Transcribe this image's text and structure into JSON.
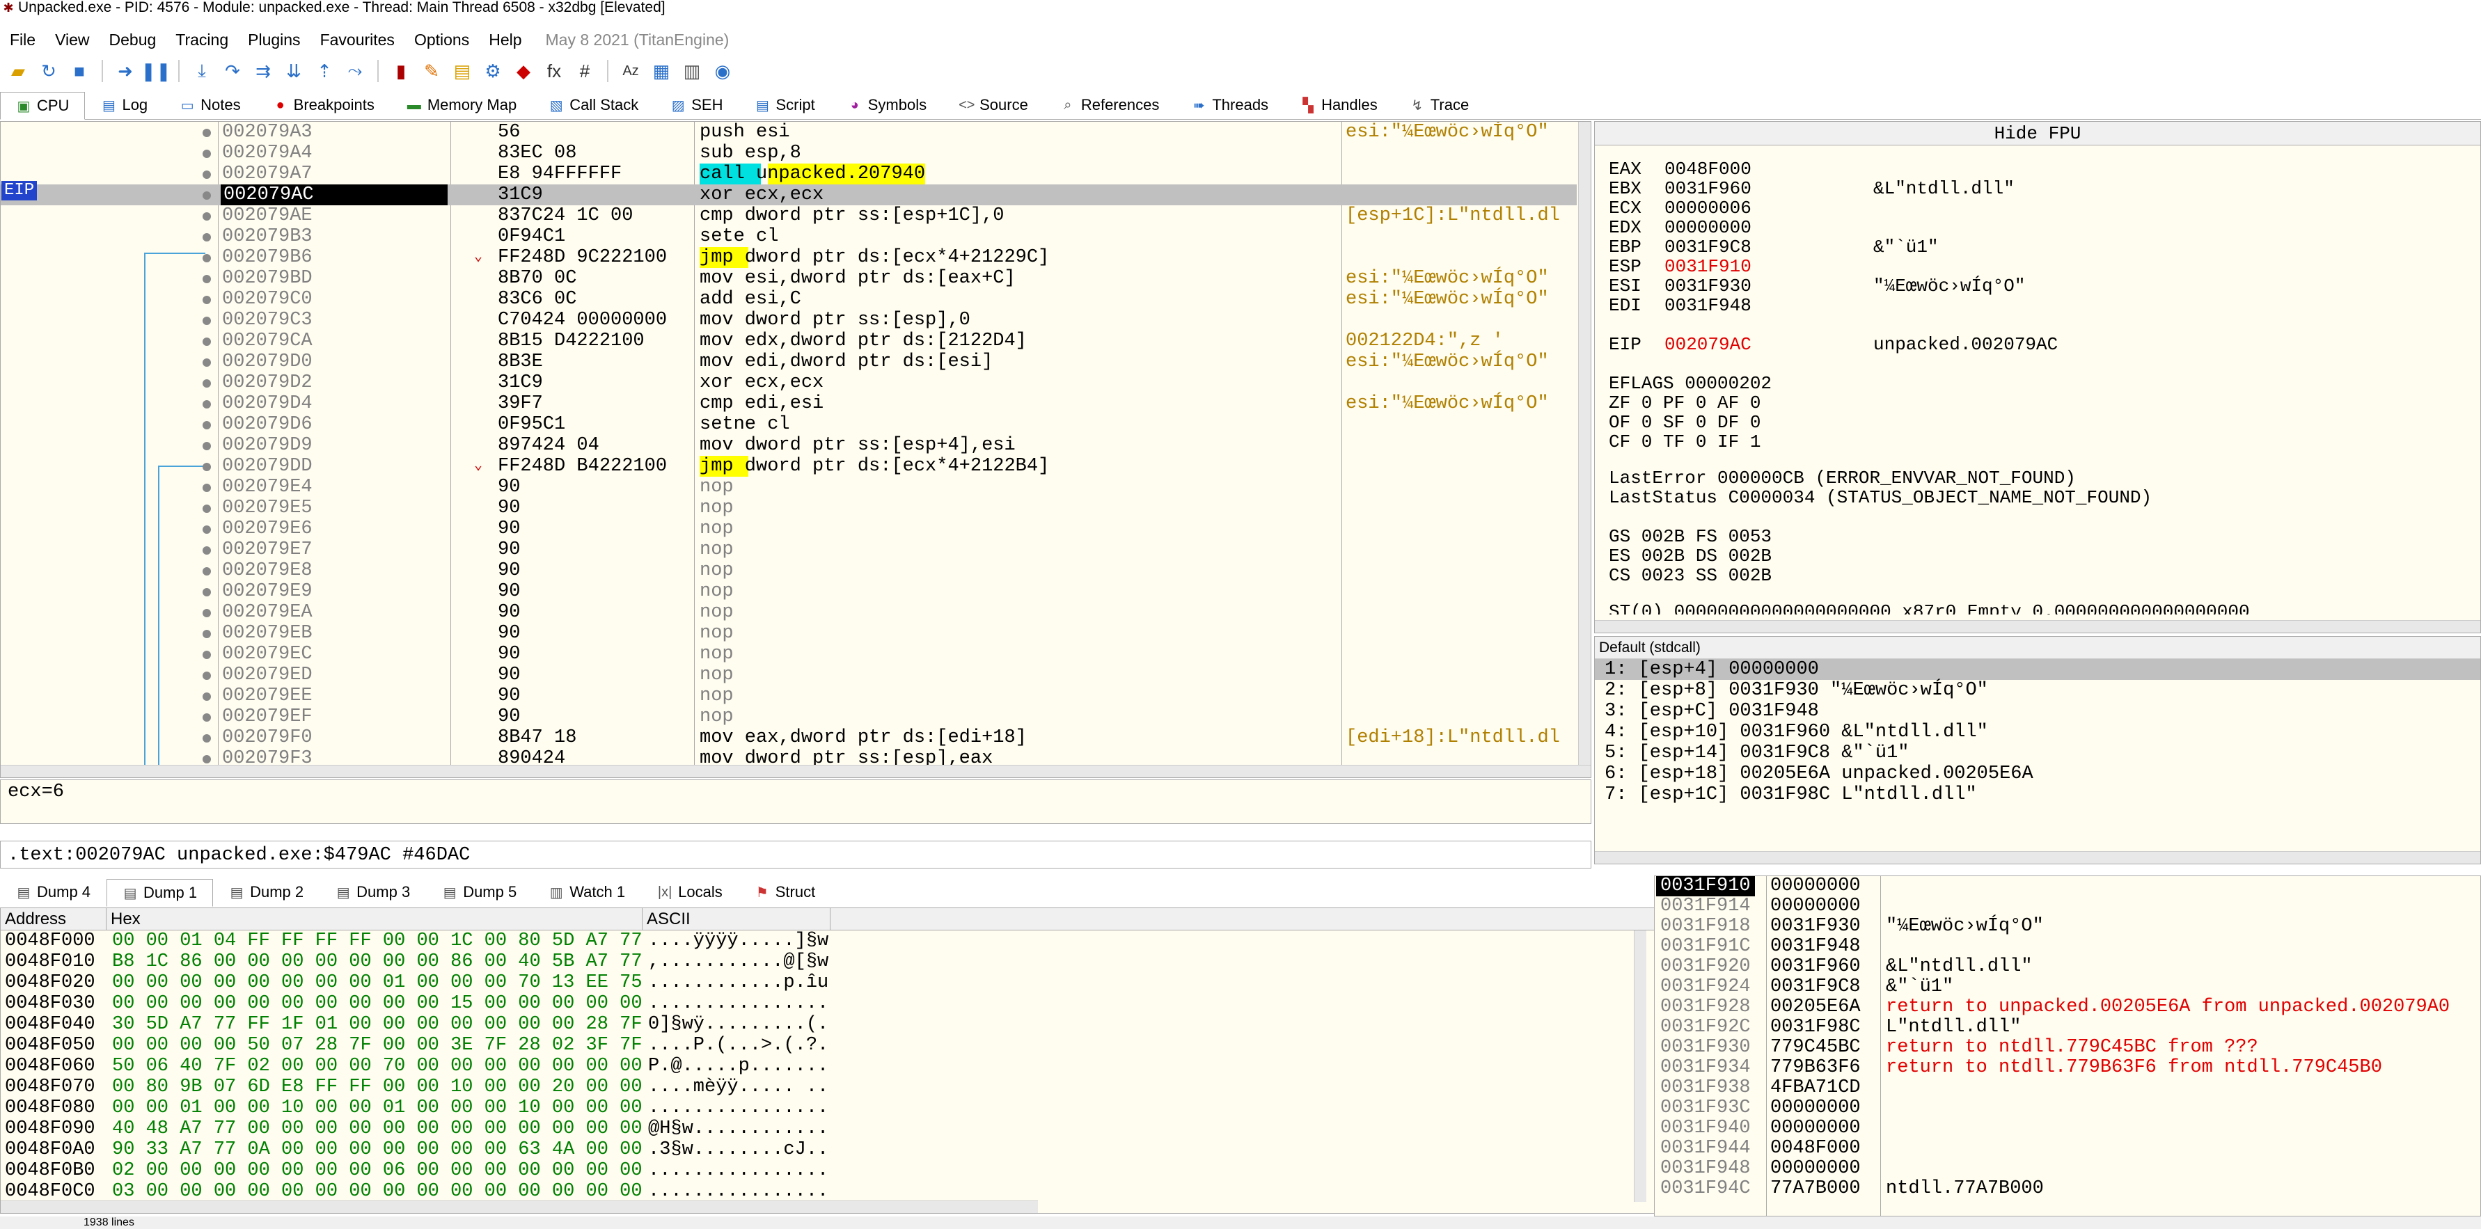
{
  "window": {
    "title": "Unpacked.exe - PID: 4576 - Module: unpacked.exe - Thread: Main Thread 6508 - x32dbg [Elevated]"
  },
  "menu": {
    "items": [
      "File",
      "View",
      "Debug",
      "Tracing",
      "Plugins",
      "Favourites",
      "Options",
      "Help"
    ],
    "date": "May 8 2021 (TitanEngine)"
  },
  "tabs": [
    {
      "label": "CPU",
      "icon": "cpu-icon"
    },
    {
      "label": "Log",
      "icon": "log-icon"
    },
    {
      "label": "Notes",
      "icon": "notes-icon"
    },
    {
      "label": "Breakpoints",
      "icon": "breakpoint-icon"
    },
    {
      "label": "Memory Map",
      "icon": "memory-icon"
    },
    {
      "label": "Call Stack",
      "icon": "callstack-icon"
    },
    {
      "label": "SEH",
      "icon": "seh-icon"
    },
    {
      "label": "Script",
      "icon": "script-icon"
    },
    {
      "label": "Symbols",
      "icon": "symbols-icon"
    },
    {
      "label": "Source",
      "icon": "source-icon"
    },
    {
      "label": "References",
      "icon": "references-icon"
    },
    {
      "label": "Threads",
      "icon": "threads-icon"
    },
    {
      "label": "Handles",
      "icon": "handles-icon"
    },
    {
      "label": "Trace",
      "icon": "trace-icon"
    }
  ],
  "disasm": {
    "eip_label": "EIP",
    "rows": [
      {
        "addr": "002079A3",
        "bytes": "56",
        "instr": "push esi",
        "cmt": "esi:\"¼Eœwöc›wÍq°O\""
      },
      {
        "addr": "002079A4",
        "bytes": "83EC 08",
        "instr": "sub esp,8",
        "cmt": ""
      },
      {
        "addr": "002079A7",
        "bytes": "E8 94FFFFFF",
        "instr": "call unpacked.207940",
        "cmt": ""
      },
      {
        "addr": "002079AC",
        "bytes": "31C9",
        "instr": "xor ecx,ecx",
        "cmt": ""
      },
      {
        "addr": "002079AE",
        "bytes": "837C24 1C 00",
        "instr": "cmp dword ptr ss:[esp+1C],0",
        "cmt": "[esp+1C]:L\"ntdll.dl"
      },
      {
        "addr": "002079B3",
        "bytes": "0F94C1",
        "instr": "sete cl",
        "cmt": ""
      },
      {
        "addr": "002079B6",
        "bytes": "FF248D 9C222100",
        "instr": "jmp dword ptr ds:[ecx*4+21229C]",
        "cmt": ""
      },
      {
        "addr": "002079BD",
        "bytes": "8B70 0C",
        "instr": "mov esi,dword ptr ds:[eax+C]",
        "cmt": "esi:\"¼Eœwöc›wÍq°O\""
      },
      {
        "addr": "002079C0",
        "bytes": "83C6 0C",
        "instr": "add esi,C",
        "cmt": "esi:\"¼Eœwöc›wÍq°O\""
      },
      {
        "addr": "002079C3",
        "bytes": "C70424 00000000",
        "instr": "mov dword ptr ss:[esp],0",
        "cmt": ""
      },
      {
        "addr": "002079CA",
        "bytes": "8B15 D4222100",
        "instr": "mov edx,dword ptr ds:[2122D4]",
        "cmt": "002122D4:\",z '"
      },
      {
        "addr": "002079D0",
        "bytes": "8B3E",
        "instr": "mov edi,dword ptr ds:[esi]",
        "cmt": "esi:\"¼Eœwöc›wÍq°O\""
      },
      {
        "addr": "002079D2",
        "bytes": "31C9",
        "instr": "xor ecx,ecx",
        "cmt": ""
      },
      {
        "addr": "002079D4",
        "bytes": "39F7",
        "instr": "cmp edi,esi",
        "cmt": "esi:\"¼Eœwöc›wÍq°O\""
      },
      {
        "addr": "002079D6",
        "bytes": "0F95C1",
        "instr": "setne cl",
        "cmt": ""
      },
      {
        "addr": "002079D9",
        "bytes": "897424 04",
        "instr": "mov dword ptr ss:[esp+4],esi",
        "cmt": ""
      },
      {
        "addr": "002079DD",
        "bytes": "FF248D B4222100",
        "instr": "jmp dword ptr ds:[ecx*4+2122B4]",
        "cmt": ""
      },
      {
        "addr": "002079E4",
        "bytes": "90",
        "instr": "nop",
        "cmt": ""
      },
      {
        "addr": "002079E5",
        "bytes": "90",
        "instr": "nop",
        "cmt": ""
      },
      {
        "addr": "002079E6",
        "bytes": "90",
        "instr": "nop",
        "cmt": ""
      },
      {
        "addr": "002079E7",
        "bytes": "90",
        "instr": "nop",
        "cmt": ""
      },
      {
        "addr": "002079E8",
        "bytes": "90",
        "instr": "nop",
        "cmt": ""
      },
      {
        "addr": "002079E9",
        "bytes": "90",
        "instr": "nop",
        "cmt": ""
      },
      {
        "addr": "002079EA",
        "bytes": "90",
        "instr": "nop",
        "cmt": ""
      },
      {
        "addr": "002079EB",
        "bytes": "90",
        "instr": "nop",
        "cmt": ""
      },
      {
        "addr": "002079EC",
        "bytes": "90",
        "instr": "nop",
        "cmt": ""
      },
      {
        "addr": "002079ED",
        "bytes": "90",
        "instr": "nop",
        "cmt": ""
      },
      {
        "addr": "002079EE",
        "bytes": "90",
        "instr": "nop",
        "cmt": ""
      },
      {
        "addr": "002079EF",
        "bytes": "90",
        "instr": "nop",
        "cmt": ""
      },
      {
        "addr": "002079F0",
        "bytes": "8B47 18",
        "instr": "mov eax,dword ptr ds:[edi+18]",
        "cmt": "[edi+18]:L\"ntdll.dl"
      },
      {
        "addr": "002079F3",
        "bytes": "890424",
        "instr": "mov dword ptr ss:[esp],eax",
        "cmt": ""
      }
    ]
  },
  "fpu": {
    "header": "Hide FPU",
    "regs": [
      {
        "n": "EAX",
        "v": "0048F000",
        "c": ""
      },
      {
        "n": "EBX",
        "v": "0031F960",
        "c": "&L\"ntdll.dll\""
      },
      {
        "n": "ECX",
        "v": "00000006",
        "c": ""
      },
      {
        "n": "EDX",
        "v": "00000000",
        "c": ""
      },
      {
        "n": "EBP",
        "v": "0031F9C8",
        "c": "&\"`ü1\""
      },
      {
        "n": "ESP",
        "v": "0031F910",
        "c": ""
      },
      {
        "n": "ESI",
        "v": "0031F930",
        "c": "\"¼Eœwöc›wÍq°O\""
      },
      {
        "n": "EDI",
        "v": "0031F948",
        "c": ""
      }
    ],
    "eip": {
      "n": "EIP",
      "v": "002079AC",
      "c": "unpacked.002079AC"
    },
    "eflags": "EFLAGS   00000202",
    "flags1": "ZF 0  PF 0  AF 0",
    "flags2": "OF 0  SF 0  DF 0",
    "flags3": "CF 0  TF 0  IF 1",
    "lasterror": "LastError  000000CB (ERROR_ENVVAR_NOT_FOUND)",
    "laststatus": "LastStatus C0000034 (STATUS_OBJECT_NAME_NOT_FOUND)",
    "seg1": "GS 002B  FS 0053",
    "seg2": "ES 002B  DS 002B",
    "seg3": "CS 0023  SS 002B",
    "st0": "ST(0) 00000000000000000000 x87r0 Empty 0.000000000000000000"
  },
  "callconv": {
    "header": "Default (stdcall)",
    "args": [
      "1: [esp+4] 00000000",
      "2: [esp+8] 0031F930 \"¼Eœwöc›wÍq°O\"",
      "3: [esp+C] 0031F948",
      "4: [esp+10] 0031F960 &L\"ntdll.dll\"",
      "5: [esp+14] 0031F9C8 &\"`ü1\"",
      "6: [esp+18] 00205E6A unpacked.00205E6A",
      "7: [esp+1C] 0031F98C L\"ntdll.dll\""
    ]
  },
  "info": {
    "text": "ecx=6",
    "address": ".text:002079AC unpacked.exe:$479AC #46DAC"
  },
  "dumptabs": [
    "Dump 4",
    "Dump 1",
    "Dump 2",
    "Dump 3",
    "Dump 5",
    "Watch 1",
    "Locals",
    "Struct"
  ],
  "dump": {
    "headers": [
      "Address",
      "Hex",
      "ASCII"
    ],
    "rows": [
      {
        "a": "0048F000",
        "h": "00 00 01 04 FF FF FF FF 00 00 1C 00 80 5D A7 77",
        "x": "....ÿÿÿÿ.....]§w"
      },
      {
        "a": "0048F010",
        "h": "B8 1C 86 00 00 00 00 00 00 00 86 00 40 5B A7 77",
        "x": ",...........@[§w"
      },
      {
        "a": "0048F020",
        "h": "00 00 00 00 00 00 00 00 01 00 00 00 70 13 EE 75",
        "x": "............p.îu"
      },
      {
        "a": "0048F030",
        "h": "00 00 00 00 00 00 00 00 00 00 15 00 00 00 00 00",
        "x": "................"
      },
      {
        "a": "0048F040",
        "h": "30 5D A7 77 FF 1F 01 00 00 00 00 00 00 00 28 7F",
        "x": "0]§wÿ.........(."
      },
      {
        "a": "0048F050",
        "h": "00 00 00 00 50 07 28 7F 00 00 3E 7F 28 02 3F 7F",
        "x": "....P.(...>.(.?."
      },
      {
        "a": "0048F060",
        "h": "50 06 40 7F 02 00 00 00 70 00 00 00 00 00 00 00",
        "x": "P.@.....p......."
      },
      {
        "a": "0048F070",
        "h": "00 80 9B 07 6D E8 FF FF 00 00 10 00 00 20 00 00",
        "x": "....mèÿÿ..... .."
      },
      {
        "a": "0048F080",
        "h": "00 00 01 00 00 10 00 00 01 00 00 00 10 00 00 00",
        "x": "................"
      },
      {
        "a": "0048F090",
        "h": "40 48 A7 77 00 00 00 00 00 00 00 00 00 00 00 00",
        "x": "@H§w............"
      },
      {
        "a": "0048F0A0",
        "h": "90 33 A7 77 0A 00 00 00 00 00 00 00 63 4A 00 00",
        "x": ".3§w........cJ.."
      },
      {
        "a": "0048F0B0",
        "h": "02 00 00 00 00 00 00 00 06 00 00 00 00 00 00 00",
        "x": "................"
      },
      {
        "a": "0048F0C0",
        "h": "03 00 00 00 00 00 00 00 00 00 00 00 00 00 00 00",
        "x": "................"
      }
    ]
  },
  "stack": {
    "rows": [
      {
        "a": "0031F910",
        "v": "00000000",
        "c": "",
        "red": false
      },
      {
        "a": "0031F914",
        "v": "00000000",
        "c": "",
        "red": false
      },
      {
        "a": "0031F918",
        "v": "0031F930",
        "c": "\"¼Eœwöc›wÍq°O\"",
        "red": false
      },
      {
        "a": "0031F91C",
        "v": "0031F948",
        "c": "",
        "red": false
      },
      {
        "a": "0031F920",
        "v": "0031F960",
        "c": "&L\"ntdll.dll\"",
        "red": false
      },
      {
        "a": "0031F924",
        "v": "0031F9C8",
        "c": "&\"`ü1\"",
        "red": false
      },
      {
        "a": "0031F928",
        "v": "00205E6A",
        "c": "return to unpacked.00205E6A from unpacked.002079A0",
        "red": true
      },
      {
        "a": "0031F92C",
        "v": "0031F98C",
        "c": "L\"ntdll.dll\"",
        "red": false
      },
      {
        "a": "0031F930",
        "v": "779C45BC",
        "c": "return to ntdll.779C45BC from ???",
        "red": true
      },
      {
        "a": "0031F934",
        "v": "779B63F6",
        "c": "return to ntdll.779B63F6 from ntdll.779C45B0",
        "red": true
      },
      {
        "a": "0031F938",
        "v": "4FBA71CD",
        "c": "",
        "red": false
      },
      {
        "a": "0031F93C",
        "v": "00000000",
        "c": "",
        "red": false
      },
      {
        "a": "0031F940",
        "v": "00000000",
        "c": "",
        "red": false
      },
      {
        "a": "0031F944",
        "v": "0048F000",
        "c": "",
        "red": false
      },
      {
        "a": "0031F948",
        "v": "00000000",
        "c": "",
        "red": false
      },
      {
        "a": "0031F94C",
        "v": "77A7B000",
        "c": "ntdll.77A7B000",
        "red": false
      }
    ]
  },
  "status": {
    "text": "1938 lines"
  }
}
